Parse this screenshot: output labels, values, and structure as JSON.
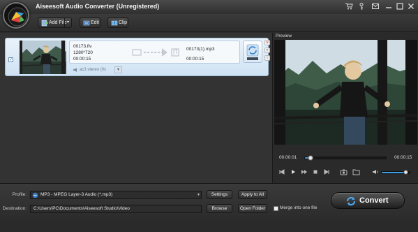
{
  "window": {
    "title": "Aiseesoft Audio Converter (Unregistered)",
    "controls": [
      "cart-icon",
      "key-icon",
      "feedback-icon",
      "minimize-icon",
      "maximize-icon",
      "close-icon"
    ]
  },
  "toolbar": {
    "add_file": "Add File",
    "edit": "Edit",
    "clip": "Clip"
  },
  "file_item": {
    "source_name": "00173.flv",
    "resolution": "1280*720",
    "source_duration": "00:00:15",
    "output_name": "00173(1).mp3",
    "output_duration": "00:00:15",
    "audio_track": "ac3 stereo (0x"
  },
  "preview": {
    "label": "Preview",
    "current_time": "00:00:01",
    "total_time": "00:00:15",
    "progress": 0.07,
    "volume": 0.85
  },
  "bottom": {
    "profile_label": "Profile:",
    "profile_value": "MP3 - MPEG Layer-3 Audio (*.mp3)",
    "settings": "Settings",
    "apply_to_all": "Apply to All",
    "destination_label": "Destination:",
    "destination_value": "C:\\Users\\PC\\Documents\\Aiseesoft Studio\\Video",
    "browse": "Browse",
    "open_folder": "Open Folder",
    "merge_label": "Merge into one file",
    "merge_checked": false,
    "convert": "Convert"
  }
}
